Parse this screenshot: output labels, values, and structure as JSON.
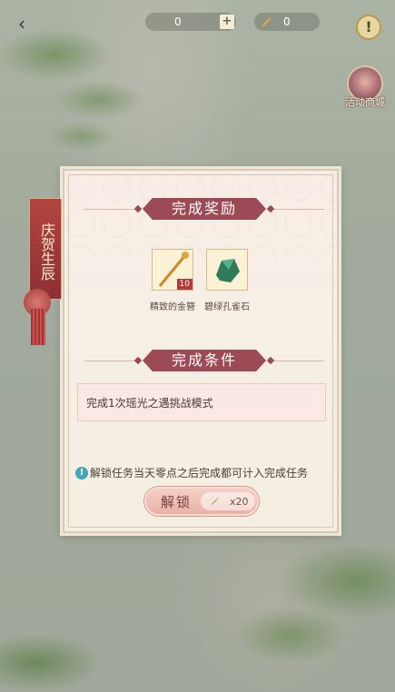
{
  "header": {
    "back_glyph": "‹",
    "currency1": {
      "value": "0",
      "icon": "feather-icon",
      "plus": "+"
    },
    "currency2": {
      "value": "0",
      "icon": "brush-icon"
    },
    "help_glyph": "!",
    "shop_label": "活动商城"
  },
  "banner": {
    "text": "庆贺生辰"
  },
  "dialog": {
    "reward_title": "完成奖励",
    "rewards": [
      {
        "name": "精致的金簪",
        "qty": "10",
        "icon": "hairpin-icon"
      },
      {
        "name": "碧绿孔雀石",
        "qty": "",
        "icon": "malachite-icon"
      }
    ],
    "condition_title": "完成条件",
    "condition_text": "完成1次瑶光之遇挑战模式",
    "notice": "解锁任务当天零点之后完成都可计入完成任务",
    "unlock": {
      "label": "解锁",
      "cost": "x20",
      "cost_icon": "feather-icon"
    }
  },
  "colors": {
    "title_bg": "#9d4a57",
    "button_bg": "#e9b1a6",
    "info": "#45a6b8"
  }
}
